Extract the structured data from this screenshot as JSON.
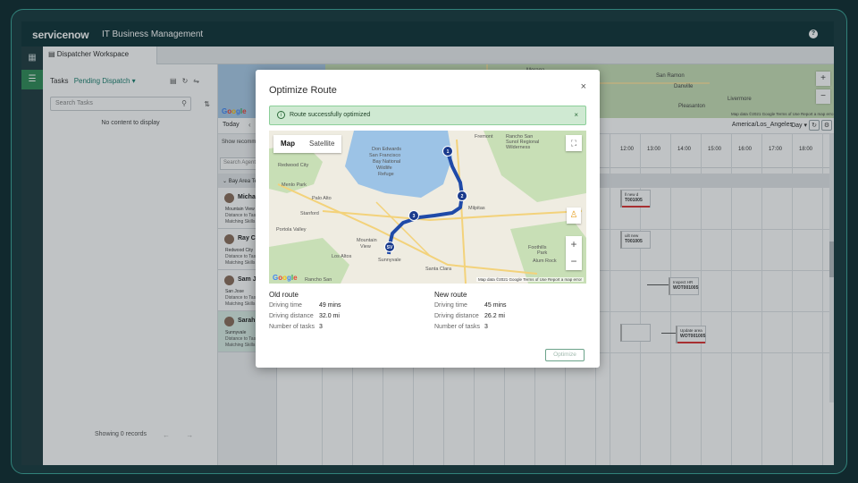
{
  "app": {
    "logo": "servicenow",
    "title": "IT Business Management",
    "help_icon": "?"
  },
  "workspace_tab": {
    "label": "Dispatcher Workspace"
  },
  "tasks": {
    "heading": "Tasks",
    "filter": "Pending Dispatch ▾",
    "search_placeholder": "Search Tasks",
    "empty": "No content to display",
    "showing": "Showing 0 records",
    "pager": "← →"
  },
  "schedule": {
    "today": "Today",
    "nav": "‹ ›",
    "timezone": "America/Los_Angeles",
    "view": "Day ▾",
    "show_recommendations": "Show recommendatio",
    "search_agents": "Search Agents",
    "group": "⌄ Bay Area Tech",
    "hours": [
      "12:00",
      "13:00",
      "14:00",
      "15:00",
      "16:00",
      "17:00",
      "18:00"
    ],
    "map_towns": [
      "Sausalito",
      "Moraga",
      "San Ramon",
      "Danville",
      "Livermore",
      "Pleasanton"
    ],
    "map_footer": "Map data ©2021 Google   Terms of Use   Report a map erro"
  },
  "agents": [
    {
      "name": "Michael V...",
      "city": "Mountain View",
      "distance": "Distance to Task  N/A",
      "skills": "Matching Skills  N/A"
    },
    {
      "name": "Ray Corne...",
      "city": "Redwood City",
      "distance": "Distance to Task  N/A",
      "skills": "Matching Skills  N/A"
    },
    {
      "name": "Sam Jones",
      "city": "San Jose",
      "distance": "Distance to Task  N/A",
      "skills": "Matching Skills  N/A"
    },
    {
      "name": "Sarah Val...",
      "city": "Sunnyvale",
      "distance": "Distance to Task  N/A",
      "skills": "Matching Skills  N/A"
    }
  ],
  "cards": [
    {
      "title": "Inspect HR",
      "id": "WOT001005"
    },
    {
      "title": "Update area",
      "id": "WOT001005"
    },
    {
      "title": "ll new d",
      "id": "T001005"
    },
    {
      "title": "uilt new",
      "id": "T001005"
    }
  ],
  "modal": {
    "title": "Optimize Route",
    "close": "×",
    "alert": "Route successfully optimized",
    "alert_close": "×",
    "map_tabs": [
      "Map",
      "Satellite"
    ],
    "map_labels": [
      "Don Edwards",
      "San Francisco",
      "Bay National",
      "Wildlife",
      "Refuge",
      "Crystal Springs",
      "Regional Open",
      "Space Preserve",
      "Redwood City",
      "Menlo Park",
      "Palo Alto",
      "Stanford",
      "Portola Valley",
      "Mountain",
      "View",
      "Los Altos",
      "Sunnyvale",
      "Santa Clara",
      "Saratoga",
      "Cupertino",
      "Rancho San",
      "Antonio",
      "Milpitas",
      "Fremont",
      "Sunol",
      "Sunol Regional",
      "Wilderness",
      "Foothills",
      "Park",
      "Joseph D. Grant",
      "Alum Rock",
      "Los Altos Hills",
      "Shoreline",
      "Rose Garden",
      "Newark",
      "Union City",
      "Alviso",
      "Berryessa",
      "Evergreen"
    ],
    "pins": [
      "1",
      "2",
      "3",
      "SV"
    ],
    "google": "Google",
    "map_footer": "Map data ©2021 Google   Terms of Use   Report a map error",
    "old_route": {
      "heading": "Old route",
      "driving_time_label": "Driving time",
      "driving_time": "49 mins",
      "driving_distance_label": "Driving distance",
      "driving_distance": "32.0 mi",
      "tasks_label": "Number of tasks",
      "tasks": "3"
    },
    "new_route": {
      "heading": "New route",
      "driving_time_label": "Driving time",
      "driving_time": "45 mins",
      "driving_distance_label": "Driving distance",
      "driving_distance": "26.2 mi",
      "tasks_label": "Number of tasks",
      "tasks": "3"
    },
    "optimize_button": "Optimize"
  }
}
